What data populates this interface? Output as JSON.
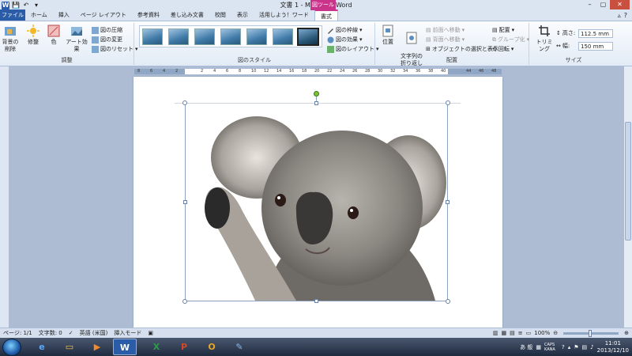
{
  "window": {
    "title": "文書 1 - Microsoft Word",
    "context_tab_group": "図ツール"
  },
  "tabs": [
    {
      "label": "ファイル"
    },
    {
      "label": "ホーム"
    },
    {
      "label": "挿入"
    },
    {
      "label": "ページ レイアウト"
    },
    {
      "label": "参考資料"
    },
    {
      "label": "差し込み文書"
    },
    {
      "label": "校閲"
    },
    {
      "label": "表示"
    },
    {
      "label": "活用しよう！ワード"
    },
    {
      "label": "書式"
    }
  ],
  "ribbon": {
    "adjust": {
      "remove_bg": "背景の削除",
      "corrections": "修整",
      "color": "色",
      "artistic": "アート効果",
      "compress": "図の圧縮",
      "change": "図の変更",
      "reset": "図のリセット",
      "label": "調整"
    },
    "styles": {
      "border": "図の枠線",
      "effects": "図の効果",
      "layout": "図のレイアウト",
      "label": "図のスタイル"
    },
    "arrange": {
      "position": "位置",
      "wrap": "文字列の\n折り返し",
      "forward": "前面へ移動",
      "backward": "背面へ移動",
      "selection": "オブジェクトの選択と表示",
      "align": "配置",
      "group": "グループ化",
      "rotate": "回転",
      "label": "配置"
    },
    "size": {
      "crop": "トリミング",
      "height_label": "高さ:",
      "height_value": "112.5 mm",
      "width_label": "幅:",
      "width_value": "150 mm",
      "label": "サイズ"
    }
  },
  "ruler": {
    "ticks": [
      "8",
      "6",
      "4",
      "2",
      "",
      "2",
      "4",
      "6",
      "8",
      "10",
      "12",
      "14",
      "16",
      "18",
      "20",
      "22",
      "24",
      "26",
      "28",
      "30",
      "32",
      "34",
      "36",
      "38",
      "40",
      "",
      "44",
      "46",
      "48"
    ]
  },
  "status": {
    "page": "ページ: 1/1",
    "words": "文字数: 0",
    "language": "英語 (米国)",
    "mode": "挿入モード",
    "zoom": "100%"
  },
  "tray": {
    "ime": "あ 般",
    "caps": "CAPS KANA",
    "time": "11:01",
    "date": "2013/12/10"
  },
  "colors": {
    "file_tab": "#2b5ca7",
    "context_tab": "#c9338a",
    "selection_handle": "#7ec23a"
  }
}
